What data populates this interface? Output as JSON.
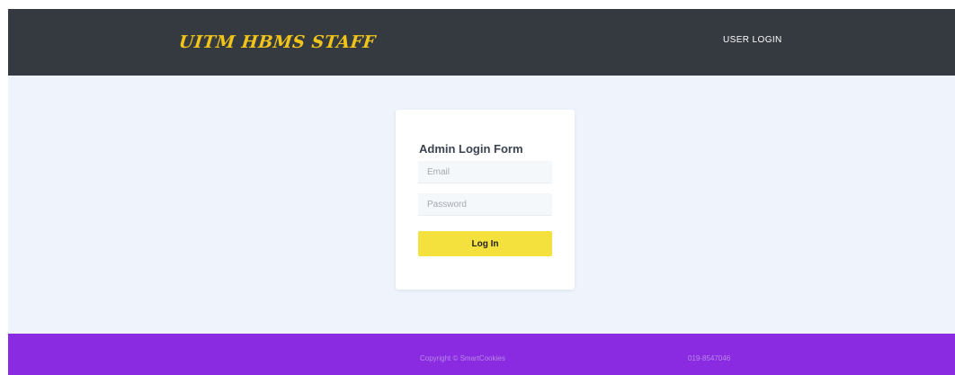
{
  "header": {
    "brand": "UITM HBMS STAFF",
    "nav_link": "USER LOGIN"
  },
  "login_form": {
    "title": "Admin Login Form",
    "email_placeholder": "Email",
    "password_placeholder": "Password",
    "submit_label": "Log In"
  },
  "footer": {
    "copyright": "Copyright © SmartCookies",
    "phone": "019-8547046"
  },
  "colors": {
    "header_bg": "#343a40",
    "brand": "#f0c419",
    "page_bg": "#eff4fc",
    "button": "#f5e13d",
    "footer_bg": "#8a2be2"
  }
}
